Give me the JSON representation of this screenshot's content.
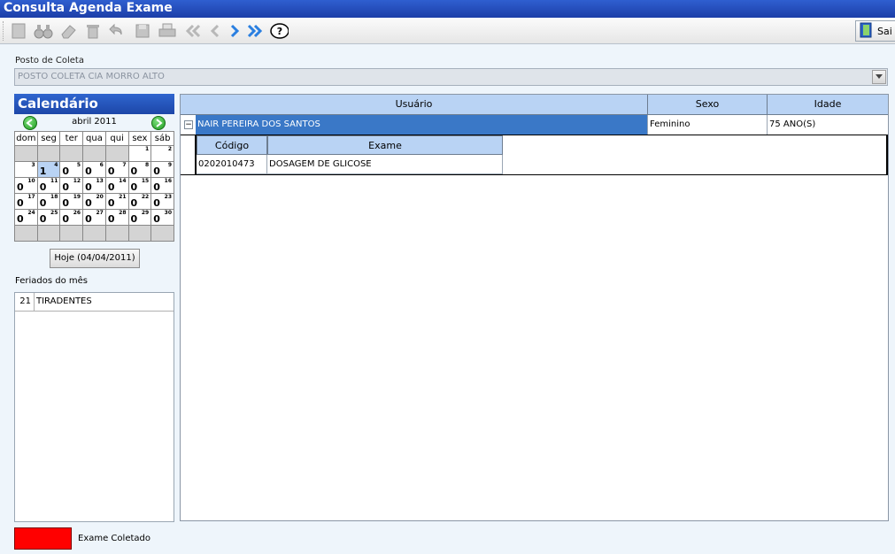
{
  "window": {
    "title": "Consulta Agenda Exame"
  },
  "toolbar": {
    "icons": [
      "new-icon",
      "search-icon",
      "erase-icon",
      "delete-icon",
      "undo-icon",
      "save-icon",
      "print-icon",
      "first-icon",
      "prev-icon",
      "next-icon",
      "last-icon",
      "help-icon",
      "exit-icon"
    ],
    "exit_label": "Sai"
  },
  "posto": {
    "label": "Posto de Coleta",
    "value": "POSTO COLETA CIA MORRO ALTO"
  },
  "calendar": {
    "title": "Calendário",
    "month_label": "abril 2011",
    "weekdays": [
      "dom",
      "seg",
      "ter",
      "qua",
      "qui",
      "sex",
      "sáb"
    ],
    "weeks": [
      [
        null,
        null,
        null,
        null,
        null,
        {
          "d": "1"
        },
        {
          "d": "2"
        }
      ],
      [
        {
          "d": "3"
        },
        {
          "d": "4",
          "c": "1",
          "today": true
        },
        {
          "d": "5",
          "c": "0"
        },
        {
          "d": "6",
          "c": "0"
        },
        {
          "d": "7",
          "c": "0"
        },
        {
          "d": "8",
          "c": "0"
        },
        {
          "d": "9",
          "c": "0"
        }
      ],
      [
        {
          "d": "10",
          "c": "0"
        },
        {
          "d": "11",
          "c": "0"
        },
        {
          "d": "12",
          "c": "0"
        },
        {
          "d": "13",
          "c": "0"
        },
        {
          "d": "14",
          "c": "0"
        },
        {
          "d": "15",
          "c": "0"
        },
        {
          "d": "16",
          "c": "0"
        }
      ],
      [
        {
          "d": "17",
          "c": "0"
        },
        {
          "d": "18",
          "c": "0"
        },
        {
          "d": "19",
          "c": "0"
        },
        {
          "d": "20",
          "c": "0"
        },
        {
          "d": "21",
          "c": "0"
        },
        {
          "d": "22",
          "c": "0"
        },
        {
          "d": "23",
          "c": "0"
        }
      ],
      [
        {
          "d": "24",
          "c": "0"
        },
        {
          "d": "25",
          "c": "0"
        },
        {
          "d": "26",
          "c": "0"
        },
        {
          "d": "27",
          "c": "0"
        },
        {
          "d": "28",
          "c": "0"
        },
        {
          "d": "29",
          "c": "0"
        },
        {
          "d": "30",
          "c": "0"
        }
      ],
      [
        null,
        null,
        null,
        null,
        null,
        null,
        null
      ]
    ],
    "today_button": "Hoje (04/04/2011)"
  },
  "feriados": {
    "label": "Feriados do mês",
    "items": [
      {
        "day": "21",
        "name": "TIRADENTES"
      }
    ]
  },
  "grid": {
    "columns": [
      "Usuário",
      "Sexo",
      "Idade"
    ],
    "row": {
      "usuario": "NAIR PEREIRA DOS SANTOS",
      "sexo": "Feminino",
      "idade": "75 ANO(S)",
      "toggle": "−"
    },
    "detail_columns": [
      "Código",
      "Exame"
    ],
    "detail_row": {
      "codigo": "0202010473",
      "exame": "DOSAGEM DE GLICOSE"
    }
  },
  "legend": {
    "color": "#ff0000",
    "label": "Exame Coletado"
  }
}
